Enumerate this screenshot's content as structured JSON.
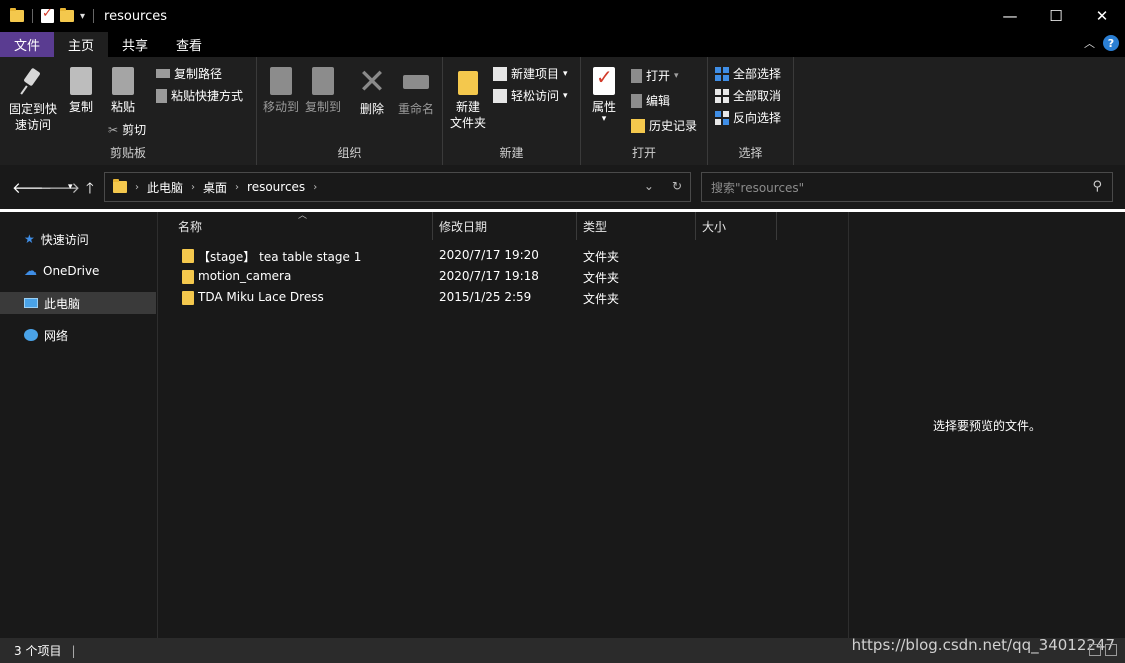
{
  "window": {
    "title": "resources",
    "min": "—",
    "max": "☐",
    "close": "✕"
  },
  "tabs": [
    "文件",
    "主页",
    "共享",
    "查看"
  ],
  "ribbon": {
    "clipboard": {
      "label": "剪贴板",
      "pin": "固定到快\n速访问",
      "copy": "复制",
      "paste": "粘贴",
      "copy_path": "复制路径",
      "paste_shortcut": "粘贴快捷方式",
      "cut": "剪切"
    },
    "organize": {
      "label": "组织",
      "move_to": "移动到",
      "copy_to": "复制到",
      "delete": "删除",
      "rename": "重命名"
    },
    "new": {
      "label": "新建",
      "new_folder": "新建\n文件夹",
      "new_item": "新建项目",
      "easy_access": "轻松访问"
    },
    "open": {
      "label": "打开",
      "properties": "属性",
      "open": "打开",
      "edit": "编辑",
      "history": "历史记录"
    },
    "select": {
      "label": "选择",
      "select_all": "全部选择",
      "select_none": "全部取消",
      "invert": "反向选择"
    }
  },
  "address": {
    "crumbs": [
      "此电脑",
      "桌面",
      "resources"
    ],
    "search_placeholder": "搜索\"resources\""
  },
  "nav": {
    "items": [
      "快速访问",
      "OneDrive",
      "此电脑",
      "网络"
    ]
  },
  "columns": {
    "name": "名称",
    "date": "修改日期",
    "type": "类型",
    "size": "大小"
  },
  "files": [
    {
      "name": "【stage】 tea table stage 1",
      "date": "2020/7/17 19:20",
      "type": "文件夹"
    },
    {
      "name": "motion_camera",
      "date": "2020/7/17 19:18",
      "type": "文件夹"
    },
    {
      "name": "TDA Miku Lace Dress",
      "date": "2015/1/25 2:59",
      "type": "文件夹"
    }
  ],
  "preview": {
    "text": "选择要预览的文件。"
  },
  "status": {
    "count": "3 个项目",
    "watermark": "https://blog.csdn.net/qq_34012247"
  },
  "colors": {
    "file_tab": "#5a3c91",
    "folder": "#f4c84d",
    "accent_blue": "#3f8ee6"
  }
}
